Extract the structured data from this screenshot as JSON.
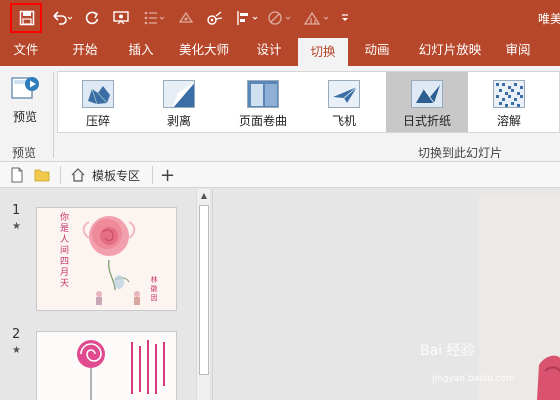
{
  "window": {
    "title_fragment": "唯美",
    "accent_color": "#b7472a",
    "highlight_color": "#ff0000"
  },
  "quick_access": {
    "items": [
      "save-icon",
      "undo-icon",
      "redo-icon",
      "slideshow-icon",
      "bullets-icon",
      "format-painter-icon",
      "record-icon",
      "align-icon",
      "shape-icon",
      "chart-icon",
      "customize-icon"
    ]
  },
  "tabs": [
    {
      "label": "文件"
    },
    {
      "label": "开始"
    },
    {
      "label": "插入"
    },
    {
      "label": "美化大师"
    },
    {
      "label": "设计"
    },
    {
      "label": "切换",
      "active": true
    },
    {
      "label": "动画"
    },
    {
      "label": "幻灯片放映"
    },
    {
      "label": "审阅"
    }
  ],
  "ribbon": {
    "preview_label": "预览",
    "preview_group_label": "预览",
    "transitions": [
      {
        "label": "压碎",
        "icon": "crush-icon"
      },
      {
        "label": "剥离",
        "icon": "peel-off-icon"
      },
      {
        "label": "页面卷曲",
        "icon": "page-curl-icon"
      },
      {
        "label": "飞机",
        "icon": "airplane-icon"
      },
      {
        "label": "日式折纸",
        "icon": "origami-icon",
        "selected": true
      },
      {
        "label": "溶解",
        "icon": "dissolve-icon"
      }
    ],
    "transitions_group_label": "切换到此幻灯片"
  },
  "docbar": {
    "template_tab_label": "模板专区",
    "add_label": "+"
  },
  "slides": [
    {
      "number": "1",
      "star": "★",
      "text": "你是人间四月天",
      "sub": "林徽因"
    },
    {
      "number": "2",
      "star": "★"
    }
  ],
  "watermark": {
    "text": "Bai 经验",
    "url": "jingyan.baidu.com"
  }
}
